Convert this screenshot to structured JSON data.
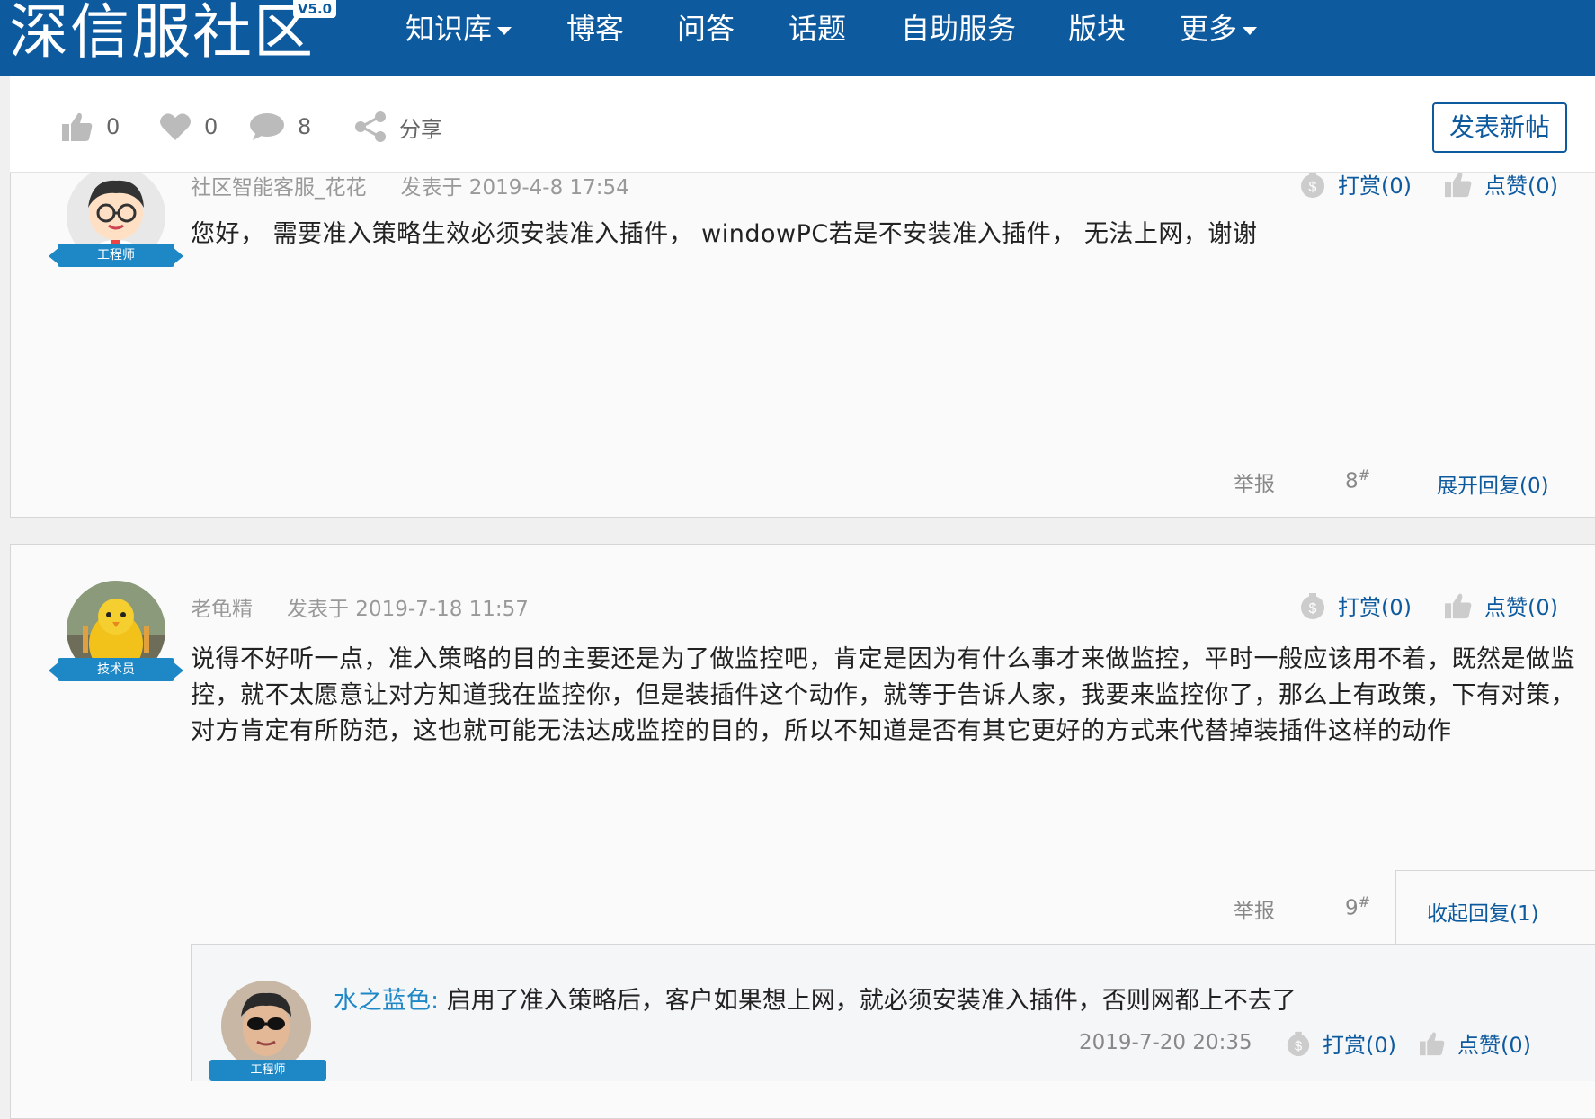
{
  "nav": {
    "logo": "深信服社区",
    "logo_version": "V5.0",
    "items": [
      {
        "label": "知识库",
        "dropdown": true
      },
      {
        "label": "博客"
      },
      {
        "label": "问答"
      },
      {
        "label": "话题"
      },
      {
        "label": "自助服务"
      },
      {
        "label": "版块"
      },
      {
        "label": "更多",
        "dropdown": true
      }
    ]
  },
  "actionbar": {
    "thumbs_count": "0",
    "heart_count": "0",
    "comment_count": "8",
    "share_label": "分享",
    "new_post_label": "发表新帖"
  },
  "posts": [
    {
      "author": "社区智能客服_花花",
      "badge": "工程师",
      "time": "发表于 2019-4-8 17:54",
      "reward": "打赏(0)",
      "like": "点赞(0)",
      "content": "您好， 需要准入策略生效必须安装准入插件， windowPC若是不安装准入插件， 无法上网，谢谢",
      "report": "举报",
      "floor": "8",
      "floor_mark": "#",
      "reply_toggle": "展开回复(0)"
    },
    {
      "author": "老龟精",
      "badge": "技术员",
      "time": "发表于 2019-7-18 11:57",
      "reward": "打赏(0)",
      "like": "点赞(0)",
      "content": "说得不好听一点，准入策略的目的主要还是为了做监控吧，肯定是因为有什么事才来做监控，平时一般应该用不着，既然是做监控，就不太愿意让对方知道我在监控你，但是装插件这个动作，就等于告诉人家，我要来监控你了，那么上有政策，下有对策，对方肯定有所防范，这也就可能无法达成监控的目的，所以不知道是否有其它更好的方式来代替掉装插件这样的动作",
      "report": "举报",
      "floor": "9",
      "floor_mark": "#",
      "reply_toggle": "收起回复(1)",
      "replies": [
        {
          "user": "水之蓝色:",
          "badge": "工程师",
          "text": "启用了准入策略后，客户如果想上网，就必须安装准入插件，否则网都上不去了",
          "time": "2019-7-20 20:35",
          "reward": "打赏(0)",
          "like": "点赞(0)"
        }
      ]
    }
  ],
  "colors": {
    "nav_bg": "#0e5a9f",
    "link": "#0e5a9f",
    "badge": "#1e88c7"
  }
}
